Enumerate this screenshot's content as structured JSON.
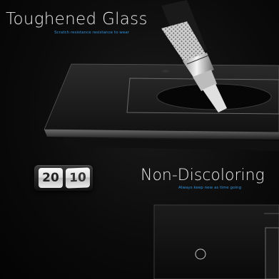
{
  "section_glass": {
    "title": "Toughened Glass",
    "subtitle": "Scratch resistance resistance to wear"
  },
  "section_color": {
    "title": "Non-Discoloring",
    "subtitle": "Always keep new as time going"
  },
  "clock": {
    "hours": "20",
    "minutes": "10"
  },
  "colors": {
    "accent_text": "#2e8fd8",
    "headline": "#e8e8e8",
    "background": "#050505"
  }
}
